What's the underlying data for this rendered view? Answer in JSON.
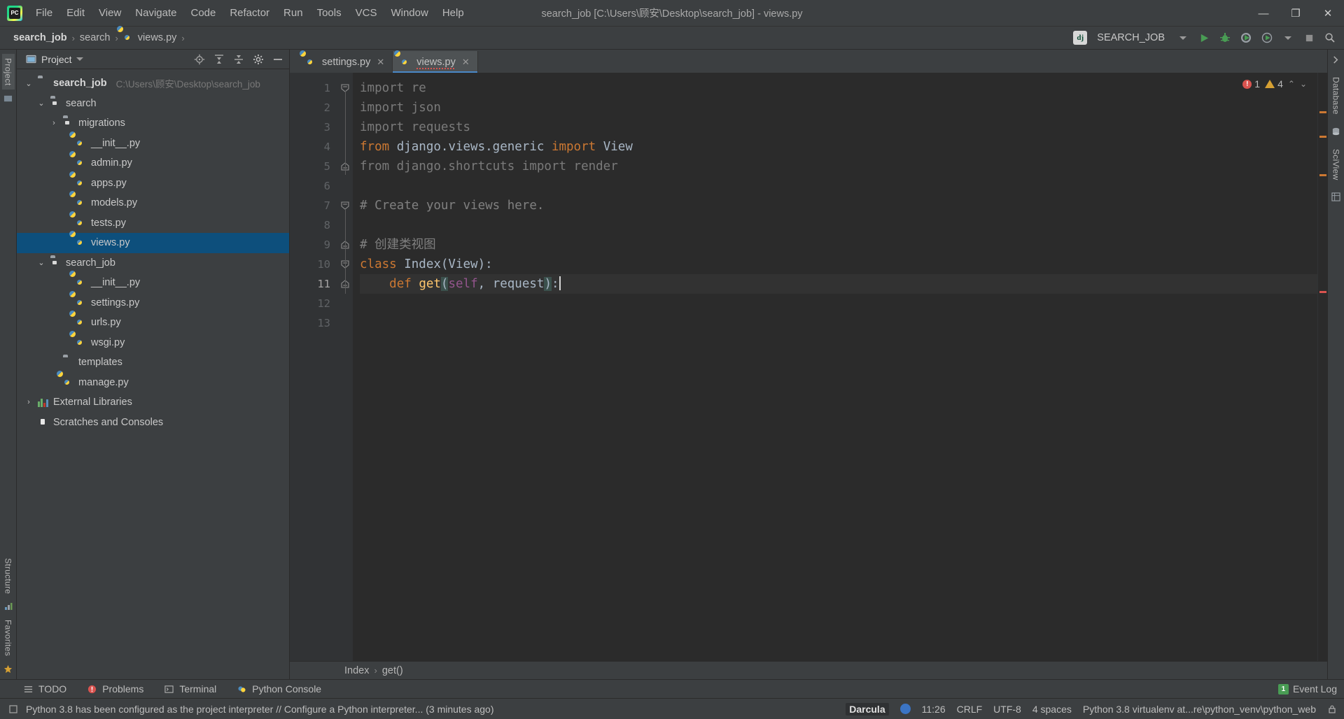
{
  "window": {
    "title": "search_job [C:\\Users\\顾安\\Desktop\\search_job] - views.py",
    "minimize": "—",
    "maximize": "❐",
    "close": "✕"
  },
  "menubar": {
    "items": [
      "File",
      "Edit",
      "View",
      "Navigate",
      "Code",
      "Refactor",
      "Run",
      "Tools",
      "VCS",
      "Window",
      "Help"
    ]
  },
  "navbar": {
    "breadcrumbs": [
      "search_job",
      "search",
      "views.py"
    ],
    "separator": "›",
    "django_badge": "dj",
    "run_config": "SEARCH_JOB"
  },
  "left_rail": {
    "top": "Project",
    "bottom": [
      "Structure",
      "Favorites"
    ]
  },
  "right_rail": {
    "items": [
      "Database",
      "SciView"
    ]
  },
  "project_panel": {
    "title": "Project",
    "tree": [
      {
        "indent": 0,
        "arrow": "⌄",
        "icon": "folder",
        "label": "search_job",
        "bold": true,
        "sub": "C:\\Users\\顾安\\Desktop\\search_job",
        "selected": false
      },
      {
        "indent": 1,
        "arrow": "⌄",
        "icon": "module",
        "label": "search",
        "bold": false,
        "sub": "",
        "selected": false
      },
      {
        "indent": 2,
        "arrow": "›",
        "icon": "module",
        "label": "migrations",
        "bold": false,
        "sub": "",
        "selected": false
      },
      {
        "indent": 3,
        "arrow": "",
        "icon": "python",
        "label": "__init__.py",
        "bold": false,
        "sub": "",
        "selected": false
      },
      {
        "indent": 3,
        "arrow": "",
        "icon": "python",
        "label": "admin.py",
        "bold": false,
        "sub": "",
        "selected": false
      },
      {
        "indent": 3,
        "arrow": "",
        "icon": "python",
        "label": "apps.py",
        "bold": false,
        "sub": "",
        "selected": false
      },
      {
        "indent": 3,
        "arrow": "",
        "icon": "python",
        "label": "models.py",
        "bold": false,
        "sub": "",
        "selected": false
      },
      {
        "indent": 3,
        "arrow": "",
        "icon": "python",
        "label": "tests.py",
        "bold": false,
        "sub": "",
        "selected": false
      },
      {
        "indent": 3,
        "arrow": "",
        "icon": "python",
        "label": "views.py",
        "bold": false,
        "sub": "",
        "selected": true
      },
      {
        "indent": 1,
        "arrow": "⌄",
        "icon": "module",
        "label": "search_job",
        "bold": false,
        "sub": "",
        "selected": false
      },
      {
        "indent": 3,
        "arrow": "",
        "icon": "python",
        "label": "__init__.py",
        "bold": false,
        "sub": "",
        "selected": false
      },
      {
        "indent": 3,
        "arrow": "",
        "icon": "python",
        "label": "settings.py",
        "bold": false,
        "sub": "",
        "selected": false
      },
      {
        "indent": 3,
        "arrow": "",
        "icon": "python",
        "label": "urls.py",
        "bold": false,
        "sub": "",
        "selected": false
      },
      {
        "indent": 3,
        "arrow": "",
        "icon": "python",
        "label": "wsgi.py",
        "bold": false,
        "sub": "",
        "selected": false
      },
      {
        "indent": 2,
        "arrow": "",
        "icon": "folder",
        "label": "templates",
        "bold": false,
        "sub": "",
        "selected": false
      },
      {
        "indent": 2,
        "arrow": "",
        "icon": "python",
        "label": "manage.py",
        "bold": false,
        "sub": "",
        "selected": false
      },
      {
        "indent": 0,
        "arrow": "›",
        "icon": "libs",
        "label": "External Libraries",
        "bold": false,
        "sub": "",
        "selected": false
      },
      {
        "indent": 0,
        "arrow": "",
        "icon": "scratch",
        "label": "Scratches and Consoles",
        "bold": false,
        "sub": "",
        "selected": false
      }
    ]
  },
  "editor": {
    "tabs": [
      {
        "label": "settings.py",
        "active": false,
        "close": "✕"
      },
      {
        "label": "views.py",
        "active": true,
        "close": "✕"
      }
    ],
    "line_numbers": [
      "1",
      "2",
      "3",
      "4",
      "5",
      "6",
      "7",
      "8",
      "9",
      "10",
      "11",
      "12",
      "13"
    ],
    "current_line": 11,
    "lines": [
      {
        "n": 1,
        "fold": "open",
        "tokens": [
          {
            "t": "import ",
            "c": "dim"
          },
          {
            "t": "re",
            "c": "dim"
          }
        ]
      },
      {
        "n": 2,
        "fold": "",
        "tokens": [
          {
            "t": "import ",
            "c": "dim"
          },
          {
            "t": "json",
            "c": "dim"
          }
        ]
      },
      {
        "n": 3,
        "fold": "",
        "tokens": [
          {
            "t": "import ",
            "c": "dim"
          },
          {
            "t": "requests",
            "c": "dim"
          }
        ]
      },
      {
        "n": 4,
        "fold": "",
        "tokens": [
          {
            "t": "from ",
            "c": "kw"
          },
          {
            "t": "django.views.generic ",
            "c": "plain"
          },
          {
            "t": "import ",
            "c": "kw"
          },
          {
            "t": "View",
            "c": "plain"
          }
        ]
      },
      {
        "n": 5,
        "fold": "close",
        "tokens": [
          {
            "t": "from django.shortcuts import render",
            "c": "dim"
          }
        ]
      },
      {
        "n": 6,
        "fold": "",
        "tokens": []
      },
      {
        "n": 7,
        "fold": "open",
        "tokens": [
          {
            "t": "# Create your views here.",
            "c": "cmt"
          }
        ]
      },
      {
        "n": 8,
        "fold": "",
        "tokens": []
      },
      {
        "n": 9,
        "fold": "close",
        "tokens": [
          {
            "t": "# 创建类视图",
            "c": "cmt"
          }
        ]
      },
      {
        "n": 10,
        "fold": "open",
        "tokens": [
          {
            "t": "class ",
            "c": "kw"
          },
          {
            "t": "Index(View):",
            "c": "plain"
          }
        ]
      },
      {
        "n": 11,
        "fold": "close",
        "tokens": [
          {
            "t": "    ",
            "c": "plain"
          },
          {
            "t": "def ",
            "c": "kw"
          },
          {
            "t": "get",
            "c": "fn"
          },
          {
            "t": "(",
            "c": "paren"
          },
          {
            "t": "self",
            "c": "selfk"
          },
          {
            "t": ", request",
            "c": "plain"
          },
          {
            "t": ")",
            "c": "paren"
          },
          {
            "t": ":",
            "c": "plain"
          }
        ]
      },
      {
        "n": 12,
        "fold": "",
        "tokens": []
      },
      {
        "n": 13,
        "fold": "",
        "tokens": []
      }
    ],
    "gutter_run_marker_line": 11,
    "inspection": {
      "error_count": "1",
      "warning_count": "4",
      "up": "⌃",
      "down": "⌄"
    },
    "breadcrumbs": [
      "Index",
      "get()"
    ],
    "breadcrumb_separator": "›"
  },
  "toolwindow_bar": {
    "items": [
      "TODO",
      "Problems",
      "Terminal",
      "Python Console"
    ],
    "event_log": "Event Log",
    "event_badge": "1"
  },
  "status_bar": {
    "message": "Python 3.8 has been configured as the project interpreter // Configure a Python interpreter... (3 minutes ago)",
    "theme": "Darcula",
    "position": "11:26",
    "line_separator": "CRLF",
    "encoding": "UTF-8",
    "indent": "4 spaces",
    "interpreter": "Python 3.8 virtualenv at...re\\python_venv\\python_web"
  },
  "colors": {
    "accent_blue": "#4a88c7",
    "selection": "#0d4f7c",
    "keyword_orange": "#cc7832",
    "function_yellow": "#ffc66d",
    "self_purple": "#94558d",
    "comment_grey": "#808080",
    "error_red": "#d9534f",
    "warning_yellow": "#d6a033",
    "green_run": "#499c54",
    "bg_editor": "#2b2b2b",
    "bg_panel": "#3c3f41"
  }
}
